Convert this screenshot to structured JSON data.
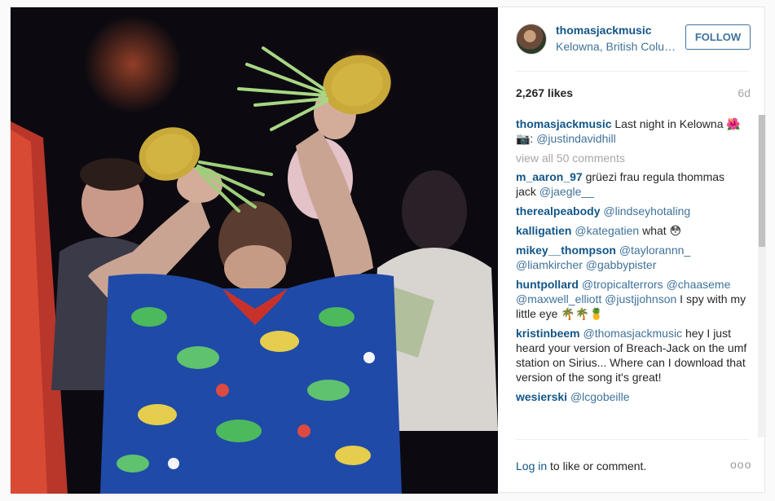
{
  "header": {
    "username": "thomasjackmusic",
    "location": "Kelowna, British Columbia",
    "follow_label": "FOLLOW"
  },
  "stats": {
    "likes": "2,267 likes",
    "age": "6d"
  },
  "caption": {
    "user": "thomasjackmusic",
    "text": " Last night in Kelowna ",
    "emoji": "🌺 📷: ",
    "mention": "@justindavidhill"
  },
  "view_all": "view all 50 comments",
  "comments": [
    {
      "user": "m_aaron_97",
      "text": " grüezi frau regula thommas jack ",
      "mentions": "@jaegle__",
      "tail": ""
    },
    {
      "user": "therealpeabody",
      "text": " ",
      "mentions": "@lindseyhotaling",
      "tail": ""
    },
    {
      "user": "kalligatien",
      "text": " ",
      "mentions": "@kategatien",
      "tail": " what 😳"
    },
    {
      "user": "mikey__thompson",
      "text": " ",
      "mentions": "@taylorannn_ @liamkircher @gabbypister",
      "tail": ""
    },
    {
      "user": "huntpollard",
      "text": " ",
      "mentions": "@tropicalterrors @chaaseme @maxwell_elliott @justjjohnson",
      "tail": " I spy with my little eye 🌴🌴🍍"
    },
    {
      "user": "kristinbeem",
      "text": " ",
      "mentions": "@thomasjackmusic",
      "tail": " hey I just heard your version of Breach-Jack on the umf station on Sirius... Where can I download that version of the song it's great!"
    },
    {
      "user": "wesierski",
      "text": " ",
      "mentions": "@lcgobeille",
      "tail": ""
    }
  ],
  "footer": {
    "login_link": "Log in",
    "login_text": " to like or comment.",
    "more": "ooo"
  },
  "colors": {
    "username": "#125688",
    "link": "#3f729b",
    "muted": "#a5a7aa",
    "border": "#e6e6e6"
  },
  "icons": {
    "more": "more-options-icon"
  }
}
